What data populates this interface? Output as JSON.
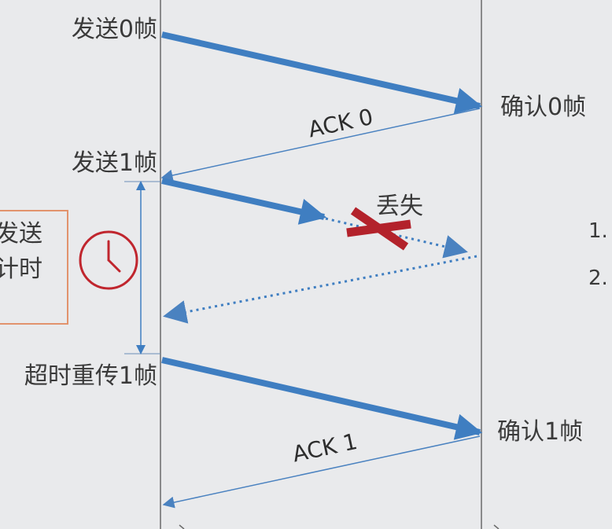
{
  "sender_labels": {
    "send0": "发送0帧",
    "send1": "发送1帧",
    "resend1": "超时重传1帧"
  },
  "receiver_labels": {
    "confirm0": "确认0帧",
    "confirm1": "确认1帧"
  },
  "ack_labels": {
    "ack0": "ACK 0",
    "ack1": "ACK 1"
  },
  "lost_label": "丢失",
  "timer_box": {
    "line1": "发送",
    "line2": "计时"
  },
  "right_list": {
    "item1": "1.",
    "item2": "2."
  },
  "icons": {
    "timer": "clock-icon",
    "lost": "cross-icon"
  },
  "colors": {
    "background": "#e9eaec",
    "data_arrow": "#3f7ec1",
    "ack_arrow": "#4a82c0",
    "lost_cross": "#b3222b",
    "clock": "#c0262e",
    "timer_box_border": "#e2936d",
    "timeline": "#6b6b6b"
  }
}
